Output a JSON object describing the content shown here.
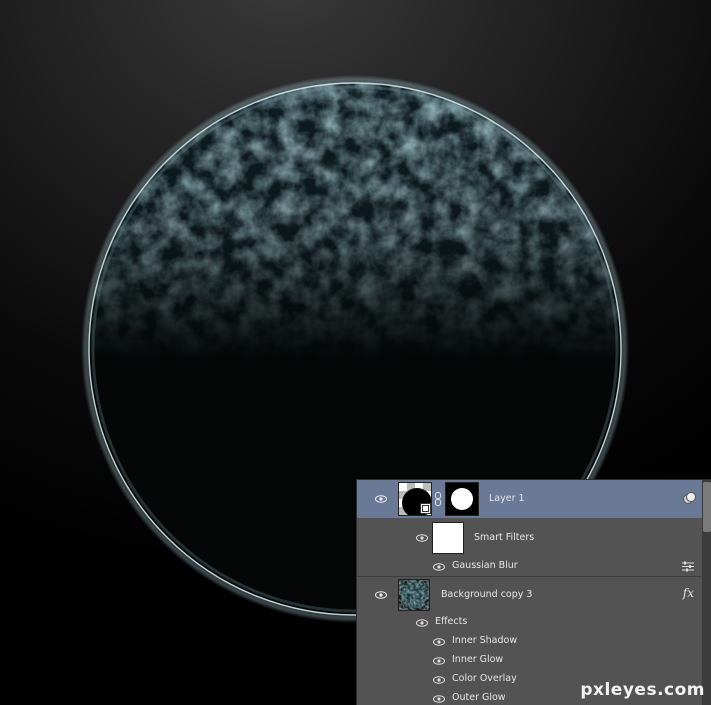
{
  "layers_panel": {
    "layers": [
      {
        "name": "Layer 1",
        "selected": true,
        "badge_icon": "smart-object-icon",
        "link_icon": "chain-link-icon"
      },
      {
        "name": "Smart Filters",
        "sub": true
      },
      {
        "name": "Gaussian Blur",
        "sub": true,
        "icon": "filter-options-icon"
      },
      {
        "name": "Background copy 3",
        "fx_label": "fx"
      },
      {
        "name": "Effects",
        "sub": true
      },
      {
        "name": "Inner Shadow",
        "sub": true
      },
      {
        "name": "Inner Glow",
        "sub": true
      },
      {
        "name": "Color Overlay",
        "sub": true
      },
      {
        "name": "Outer Glow",
        "sub": true
      }
    ]
  },
  "watermark": "pxleyes.com",
  "colors": {
    "panel_bg": "#535353",
    "selected_row": "#6a7995",
    "planet_rim": "#cfe6ea",
    "planet_surface": "#3d6570"
  }
}
